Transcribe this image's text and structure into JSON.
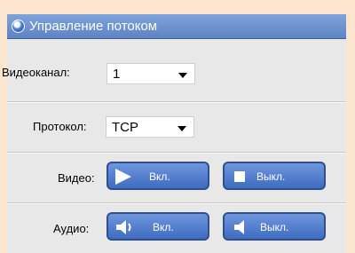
{
  "panel": {
    "title": "Управление потоком",
    "title_icon": "circle-icon"
  },
  "video_channel": {
    "label": "Видеоканал:",
    "value": "1"
  },
  "protocol": {
    "label": "Протокол:",
    "value": "TCP"
  },
  "video": {
    "label": "Видео:",
    "on_label": "Вкл.",
    "off_label": "Выкл.",
    "on_icon": "play-icon",
    "off_icon": "stop-icon"
  },
  "audio": {
    "label": "Аудио:",
    "on_label": "Вкл.",
    "off_label": "Выкл.",
    "on_icon": "speaker-on-icon",
    "off_icon": "speaker-off-icon"
  }
}
